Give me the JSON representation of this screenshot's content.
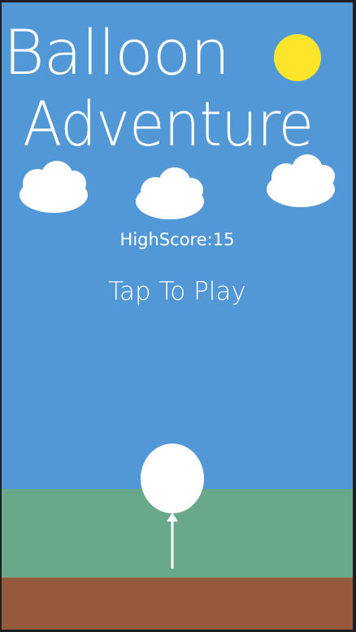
{
  "title": {
    "line1": "Balloon",
    "line2": "Adventure"
  },
  "highscore_text": "HighScore:15",
  "tap_to_play": "Tap To Play",
  "icons": [
    "sun-icon",
    "cloud-icon",
    "balloon-icon"
  ],
  "colors": {
    "sky": "#5398d6",
    "sun": "#fde52c",
    "cloud": "#ffffff",
    "grass": "#69a88a",
    "dirt": "#955a3b",
    "balloon": "#ffffff",
    "text": "#ffffff"
  }
}
